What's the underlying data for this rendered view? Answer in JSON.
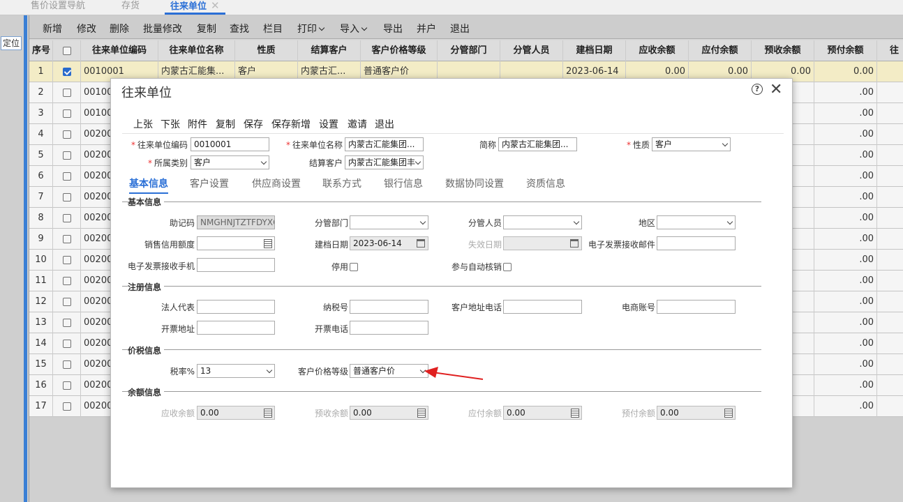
{
  "tabs": [
    {
      "label": "售价设置导航"
    },
    {
      "label": "存货"
    },
    {
      "label": "往来单位",
      "close": "✕"
    }
  ],
  "locate_button": "定位",
  "toolbar": {
    "items": [
      "新增",
      "修改",
      "删除",
      "批量修改",
      "复制",
      "查找",
      "栏目",
      "打印",
      "导入",
      "导出",
      "并户",
      "退出"
    ]
  },
  "grid": {
    "columns": [
      "序号",
      "",
      "往来单位编码",
      "往来单位名称",
      "性质",
      "结算客户",
      "客户价格等级",
      "分管部门",
      "分管人员",
      "建档日期",
      "应收余额",
      "应付余额",
      "预收余额",
      "预付余额",
      "往"
    ],
    "first_row": {
      "seq": "1",
      "code": "0010001",
      "name": "内蒙古汇能集...",
      "nature": "客户",
      "settle": "内蒙古汇...",
      "price_level": "普通客户价",
      "dept": "",
      "person": "",
      "date": "2023-06-14",
      "ar": "0.00",
      "ap": "0.00",
      "pre_r": "0.00",
      "pre_p": "0.00"
    },
    "rows": [
      {
        "seq": "2",
        "code": "00100"
      },
      {
        "seq": "3",
        "code": "00100"
      },
      {
        "seq": "4",
        "code": "00200"
      },
      {
        "seq": "5",
        "code": "00200"
      },
      {
        "seq": "6",
        "code": "00200"
      },
      {
        "seq": "7",
        "code": "00200"
      },
      {
        "seq": "8",
        "code": "00200"
      },
      {
        "seq": "9",
        "code": "00200"
      },
      {
        "seq": "10",
        "code": "00200"
      },
      {
        "seq": "11",
        "code": "00200"
      },
      {
        "seq": "12",
        "code": "00200"
      },
      {
        "seq": "13",
        "code": "00200"
      },
      {
        "seq": "14",
        "code": "00200"
      },
      {
        "seq": "15",
        "code": "00200"
      },
      {
        "seq": "16",
        "code": "00200"
      },
      {
        "seq": "17",
        "code": "00200"
      }
    ],
    "right_value": ".00"
  },
  "dialog": {
    "title": "往来单位",
    "help": "?",
    "close": "✕",
    "toolbar": [
      "上张",
      "下张",
      "附件",
      "复制",
      "保存",
      "保存新增",
      "设置",
      "邀请",
      "退出"
    ],
    "header": {
      "code_label": "往来单位编码",
      "code_value": "0010001",
      "name_label": "往来单位名称",
      "name_value": "内蒙古汇能集团...",
      "short_label": "简称",
      "short_value": "内蒙古汇能集团...",
      "nature_label": "性质",
      "nature_value": "客户",
      "category_label": "所属类别",
      "category_value": "客户",
      "settle_label": "结算客户",
      "settle_value": "内蒙古汇能集团丰"
    },
    "form_tabs": [
      "基本信息",
      "客户设置",
      "供应商设置",
      "联系方式",
      "银行信息",
      "数据协同设置",
      "资质信息"
    ],
    "basic": {
      "section": "基本信息",
      "mnemonic_label": "助记码",
      "mnemonic_value": "NMGHNJTZTFDYXG",
      "dept_label": "分管部门",
      "person_label": "分管人员",
      "region_label": "地区",
      "credit_label": "销售信用额度",
      "created_label": "建档日期",
      "created_value": "2023-06-14",
      "expire_label": "失效日期",
      "email_label": "电子发票接收邮件",
      "phone_label": "电子发票接收手机",
      "disabled_label": "停用",
      "auto_label": "参与自动核销"
    },
    "register": {
      "section": "注册信息",
      "legal_label": "法人代表",
      "tax_label": "纳税号",
      "addr_label": "客户地址电话",
      "ecom_label": "电商账号",
      "inv_addr_label": "开票地址",
      "inv_phone_label": "开票电话"
    },
    "price": {
      "section": "价税信息",
      "rate_label": "税率%",
      "rate_value": "13",
      "level_label": "客户价格等级",
      "level_value": "普通客户价"
    },
    "balance": {
      "section": "余额信息",
      "ar_label": "应收余额",
      "ar_value": "0.00",
      "pre_r_label": "预收余额",
      "pre_r_value": "0.00",
      "ap_label": "应付余额",
      "ap_value": "0.00",
      "pre_p_label": "预付余额",
      "pre_p_value": "0.00"
    }
  },
  "colors": {
    "accent": "#2a6fd6",
    "selected_row": "#fdf6cf",
    "arrow": "#e02020",
    "required": "#e33333"
  }
}
